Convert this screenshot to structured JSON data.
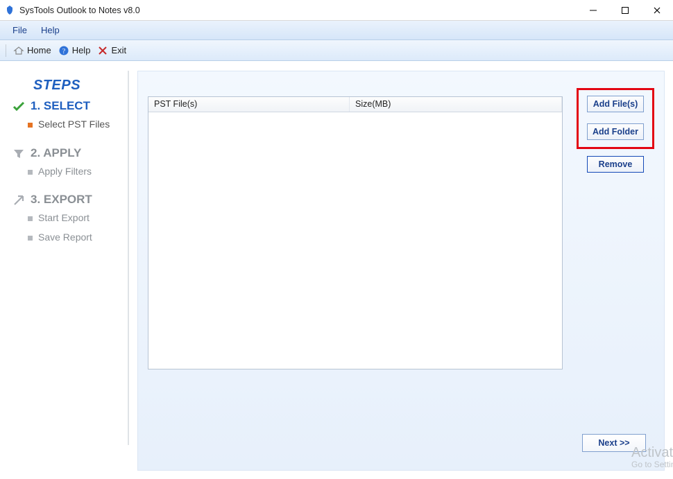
{
  "window": {
    "title": "SysTools Outlook to Notes v8.0"
  },
  "menubar": {
    "file": "File",
    "help": "Help"
  },
  "toolbar": {
    "home": "Home",
    "help": "Help",
    "exit": "Exit"
  },
  "sidebar": {
    "heading": "STEPS",
    "steps": [
      {
        "title": "1. SELECT",
        "active": true,
        "subs": [
          "Select PST Files"
        ]
      },
      {
        "title": "2. APPLY",
        "active": false,
        "subs": [
          "Apply Filters"
        ]
      },
      {
        "title": "3. EXPORT",
        "active": false,
        "subs": [
          "Start Export",
          "Save Report"
        ]
      }
    ]
  },
  "grid": {
    "col1": "PST File(s)",
    "col2": "Size(MB)"
  },
  "buttons": {
    "add_files": "Add File(s)",
    "add_folder": "Add Folder",
    "remove": "Remove",
    "next": "Next >>"
  },
  "watermark": {
    "line1": "Activate Windows",
    "line2": "Go to Settings to activate Windows."
  }
}
